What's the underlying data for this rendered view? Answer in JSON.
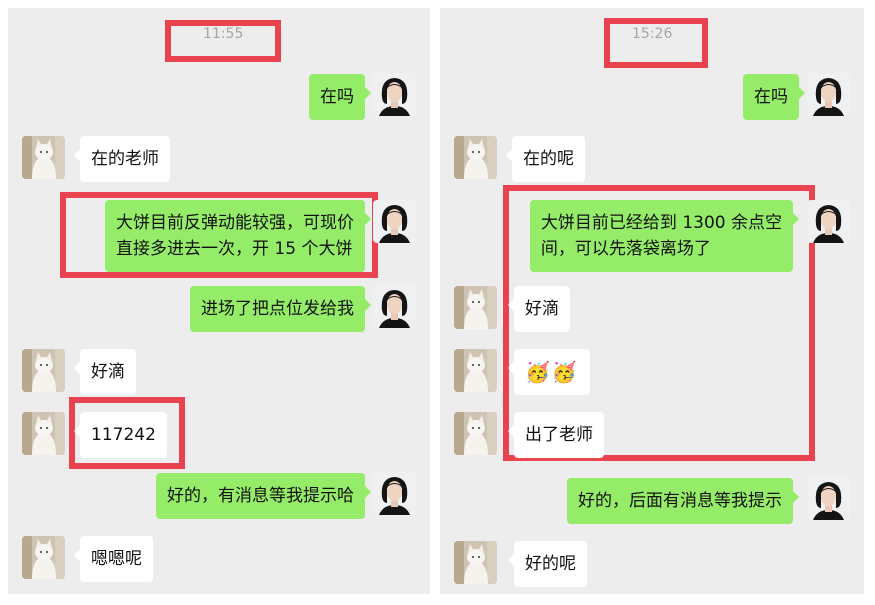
{
  "left": {
    "timestamp": "11:55",
    "messages": [
      {
        "from": "me",
        "text": "在吗"
      },
      {
        "from": "other",
        "text": "在的老师"
      },
      {
        "from": "me",
        "line1": "大饼目前反弹动能较强，可现价",
        "line2": "直接多进去一次，开 15 个大饼"
      },
      {
        "from": "me",
        "text": "进场了把点位发给我"
      },
      {
        "from": "other",
        "text": "好滴"
      },
      {
        "from": "other",
        "text": "117242"
      },
      {
        "from": "me",
        "text": "好的，有消息等我提示哈"
      },
      {
        "from": "other",
        "text": "嗯嗯呢"
      }
    ]
  },
  "right": {
    "timestamp": "15:26",
    "messages": [
      {
        "from": "me",
        "text": "在吗"
      },
      {
        "from": "other",
        "text": "在的呢"
      },
      {
        "from": "me",
        "line1": "大饼目前已经给到 1300 余点空",
        "line2": "间，可以先落袋离场了"
      },
      {
        "from": "other",
        "text": "好滴"
      },
      {
        "from": "other",
        "text": "🥳🥳"
      },
      {
        "from": "other",
        "text": "出了老师"
      },
      {
        "from": "me",
        "text": "好的，后面有消息等我提示"
      },
      {
        "from": "other",
        "text": "好的呢"
      }
    ]
  },
  "colors": {
    "highlight": "#e8434f",
    "my_bubble": "#95ec69",
    "other_bubble": "#ffffff",
    "background": "#ededed"
  }
}
